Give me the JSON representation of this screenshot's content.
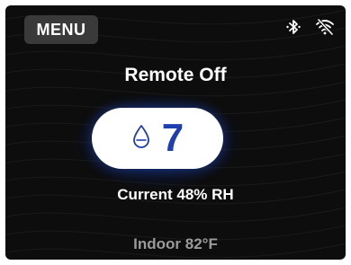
{
  "header": {
    "menu_label": "MENU",
    "icons": [
      "bluetooth-icon",
      "wifi-off-icon"
    ]
  },
  "main": {
    "mode_title": "Remote Off",
    "setpoint": {
      "icon": "water-drop-icon",
      "value": "7"
    },
    "current_humidity": "Current 48% RH",
    "indoor_temperature": "Indoor 82°F"
  },
  "colors": {
    "background": "#0d0d0d",
    "accent": "#1f3fb0",
    "menu_bg": "#3a3a3a",
    "secondary_text": "#9a9a9a"
  }
}
